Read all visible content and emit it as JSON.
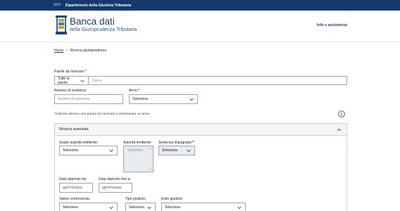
{
  "topbar": {
    "ministry_abbr": "MEF",
    "department": "Dipartimento della Giustizia Tributaria"
  },
  "header": {
    "title": "Banca dati",
    "subtitle": "della Giurisprudenza Tributaria",
    "info_link": "Info e assistenza"
  },
  "breadcrumb": {
    "home": "Home",
    "separator": "/",
    "current": "Ricerca giurisprudenza"
  },
  "search": {
    "label": "Parole da ricercare:*",
    "mode_value": "Tutte le parole",
    "placeholder": "Cerca"
  },
  "sentence_number": {
    "label": "Numero di sentenza:",
    "placeholder": "Numero di sentenza"
  },
  "year": {
    "label": "Anno:*",
    "value": "Seleziona"
  },
  "note": "*Indicare almeno una parola da ricercare o selezionare un anno.",
  "advanced": {
    "title": "Ricerca avanzata",
    "grado_label": "Grado autorità emittente:",
    "grado_value": "Seleziona",
    "autorita_label": "Autorità emittente:",
    "autorita_value": "Seleziona",
    "impugnata_label": "Sentenza impugnata:**",
    "impugnata_value": "Seleziona",
    "deposito_da_label": "Data deposito da:",
    "deposito_da_placeholder": "gg/mm/aaaa",
    "deposito_a_label": "Data deposito fino a:",
    "deposito_a_placeholder": "gg/mm/aaaa",
    "valore_label": "Valore controversia:",
    "valore_value": "Seleziona",
    "tipo_label": "Tipo giudizio:",
    "tipo_value": "Seleziona",
    "esito_label": "Esito giudizio:",
    "esito_value": "Seleziona"
  },
  "colors": {
    "topbar": "#15396b",
    "brand": "#123f74",
    "accent": "#1e5b97"
  },
  "icons": [
    "logo-icon",
    "chevron-down-icon",
    "info-icon",
    "chevron-up-icon"
  ]
}
